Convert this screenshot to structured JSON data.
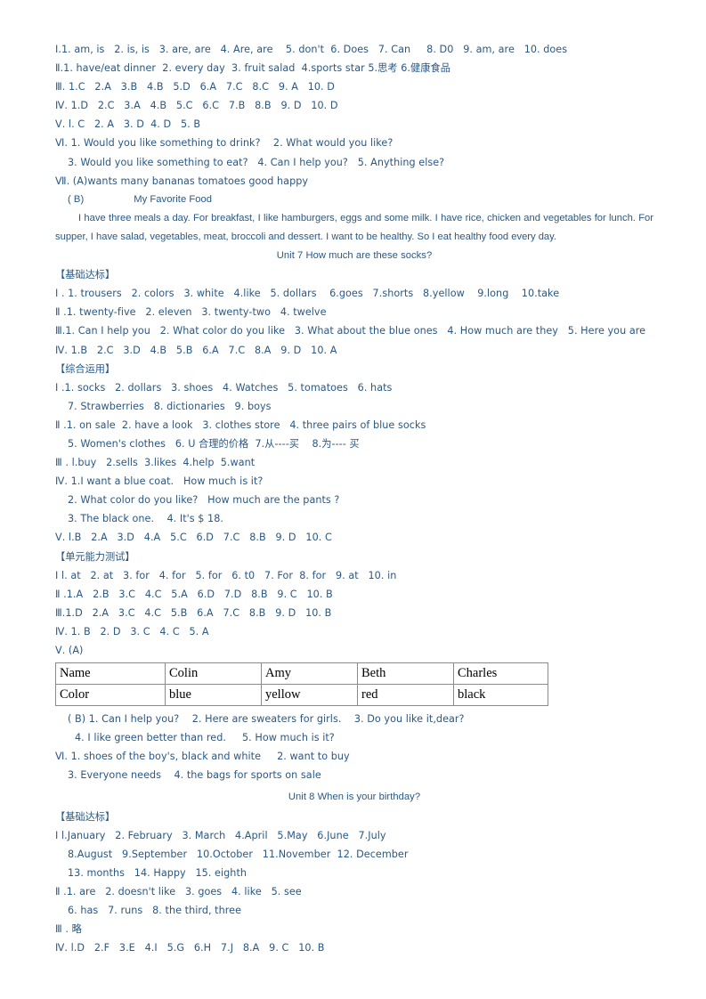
{
  "document": {
    "text_color": "#2a5885",
    "table_border_color": "#8a8a8a",
    "table_text_color": "#000000"
  },
  "unit6": {
    "l1": "Ⅰ.1. am, is   2. is, is   3. are, are   4. Are, are    5. don't  6. Does   7. Can     8. D0   9. am, are   10. does",
    "l2": "Ⅱ.1. have/eat dinner  2. every day  3. fruit salad  4.sports star 5.思考 6.健康食品",
    "l3": "Ⅲ. 1.C   2.A   3.B   4.B   5.D   6.A   7.C   8.C   9. A   10. D",
    "l4": "Ⅳ. 1.D   2.C   3.A   4.B   5.C   6.C   7.B   8.B   9. D   10. D",
    "l5": "Ⅴ. l. C   2. A   3. D  4. D   5. B",
    "l6": "Ⅵ. 1. Would you like something to drink?    2. What would you like?",
    "l7": "3. Would you like something to eat?   4. Can I help you?   5. Anything else?",
    "l8": "Ⅶ. (A)wants many bananas tomatoes good happy",
    "reading_label": "( B)",
    "reading_title": "My Favorite Food",
    "reading_body": "I have three meals a day. For breakfast, I like hamburgers, eggs and some milk. I have rice, chicken and vegetables for lunch. For supper, I have salad, vegetables, meat, broccoli and dessert. I want to be healthy. So I eat healthy food every day."
  },
  "unit7": {
    "heading": "Unit 7   How much are these socks?",
    "basic_label": "【基础达标】",
    "b1": "Ⅰ . 1. trousers   2. colors   3. white   4.like   5. dollars    6.goes   7.shorts   8.yellow    9.long    10.take",
    "b2": "Ⅱ .1. twenty-five   2. eleven   3. twenty-two   4. twelve",
    "b3": "Ⅲ.1. Can I help you   2. What color do you like   3. What about the blue ones   4. How much are they   5. Here you are",
    "b4": "Ⅳ. 1.B   2.C   3.D   4.B   5.B   6.A   7.C   8.A   9. D   10. A",
    "comp_label": "【综合运用】",
    "c1": "Ⅰ .1. socks   2. dollars   3. shoes   4. Watches   5. tomatoes   6. hats",
    "c2": "7. Strawberries   8. dictionaries   9. boys",
    "c3": "Ⅱ .1. on sale  2. have a look   3. clothes store   4. three pairs of blue socks",
    "c4": "5. Women's clothes   6. U 合理的价格  7.从----买    8.为---- 买",
    "c5": "Ⅲ . l.buy   2.sells  3.likes  4.help  5.want",
    "c6": "Ⅳ. 1.I want a blue coat.   How much is it?",
    "c7": "2. What color do you like?   How much are the pants ?",
    "c8": "3. The black one.    4. It's $ 18.",
    "c9": "Ⅴ. l.B   2.A   3.D   4.A   5.C   6.D   7.C   8.B   9. D   10. C",
    "test_label": "【单元能力测试】",
    "t1": "Ⅰ l. at   2. at   3. for   4. for   5. for   6. t0   7. For  8. for   9. at   10. in",
    "t2": "Ⅱ .1.A   2.B   3.C   4.C   5.A   6.D   7.D   8.B   9. C   10. B",
    "t3": "Ⅲ.1.D   2.A   3.C   4.C   5.B   6.A   7.C   8.B   9. D   10. B",
    "t4": "Ⅳ. 1. B   2. D   3. C   4. C   5. A",
    "t5": "Ⅴ. (A)",
    "table": {
      "rows": [
        [
          "Name",
          "Colin",
          "Amy",
          "Beth",
          "Charles"
        ],
        [
          "Color",
          "blue",
          "yellow",
          "red",
          "black"
        ]
      ]
    },
    "t6": "( B) 1. Can I help you?    2. Here are sweaters for girls.    3. Do you like it,dear?",
    "t7": "4. I like green better than red.     5. How much is it?",
    "t8": "Ⅵ. 1. shoes of the boy's, black and white     2. want to buy",
    "t9": "3. Everyone needs    4. the bags for sports on sale"
  },
  "unit8": {
    "heading": "Unit 8   When is your birthday?",
    "basic_label": "【基础达标】",
    "b1": "Ⅰ l.January   2. February   3. March   4.April   5.May   6.June   7.July",
    "b2": "8.August   9.September   10.October   11.November  12. December",
    "b3": "13. months   14. Happy   15. eighth",
    "b4": "Ⅱ .1. are   2. doesn't like   3. goes   4. like   5. see",
    "b5": "6. has   7. runs   8. the third, three",
    "b6": "Ⅲ . 略",
    "b7": "Ⅳ. l.D   2.F   3.E   4.I   5.G   6.H   7.J   8.A   9. C   10. B"
  }
}
